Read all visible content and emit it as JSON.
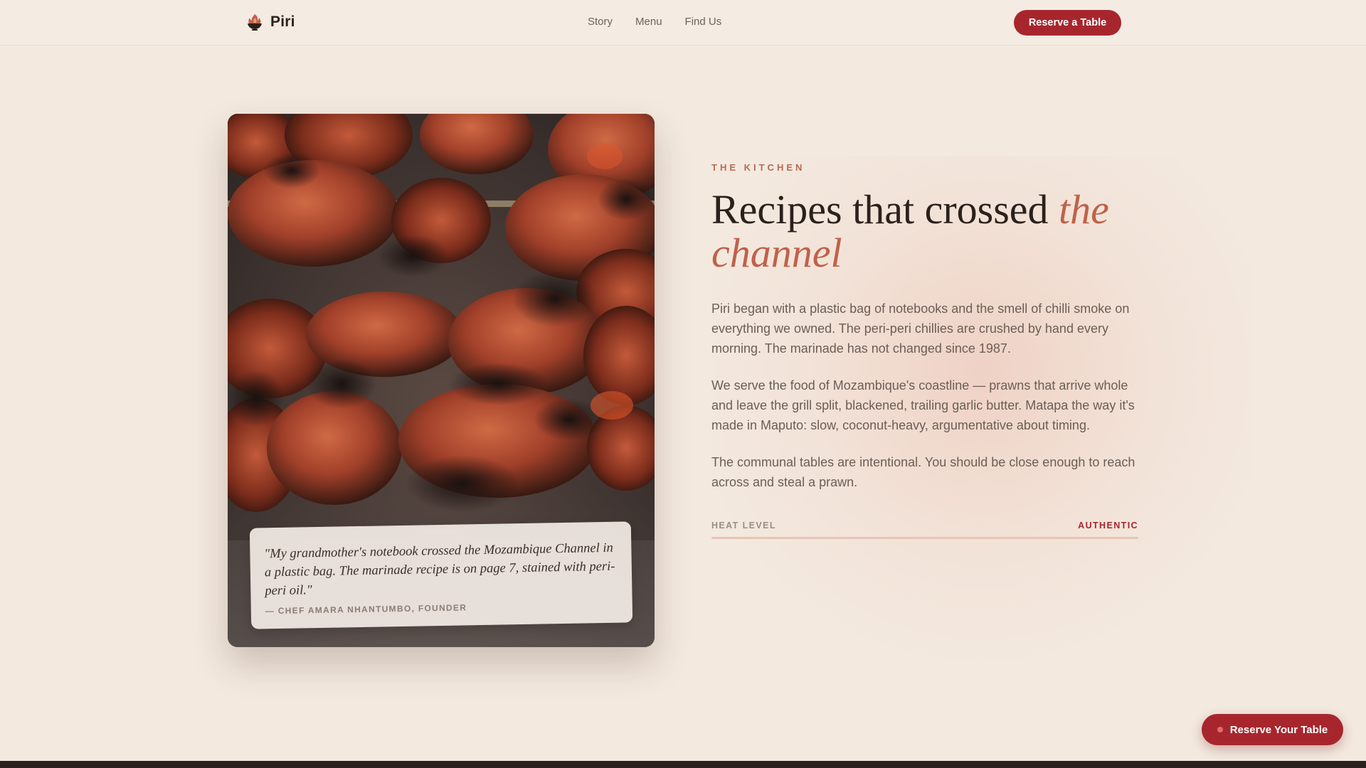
{
  "header": {
    "brand": "Piri",
    "brand_icon": "flame-bowl-icon",
    "nav": [
      "Story",
      "Menu",
      "Find Us"
    ],
    "cta": "Reserve a Table"
  },
  "photo": {
    "alt": "grilled skewers icon",
    "quote": "\"My grandmother's notebook crossed the Mozambique Channel in a plastic bag. The marinade recipe is on page 7, stained with peri-peri oil.\"",
    "author": "— CHEF AMARA NHANTUMBO, FOUNDER"
  },
  "story": {
    "eyebrow": "THE KITCHEN",
    "headline_plain": "Recipes that crossed ",
    "headline_em": "the channel",
    "paragraphs": [
      "Piri began with a plastic bag of notebooks and the smell of chilli smoke on everything we owned. The peri-peri chillies are crushed by hand every morning. The marinade has not changed since 1987.",
      "We serve the food of Mozambique's coastline — prawns that arrive whole and leave the grill split, blackened, trailing garlic butter. Matapa the way it's made in Maputo: slow, coconut-heavy, argumentative about timing.",
      "The communal tables are intentional. You should be close enough to reach across and steal a prawn."
    ],
    "heat_label": "HEAT LEVEL",
    "heat_value": "AUTHENTIC",
    "heat_level_fraction": 1.0
  },
  "floating_cta": "Reserve Your Table",
  "colors": {
    "accent": "#a7262d",
    "background": "#f3e9df",
    "headline_em": "#c0614a"
  }
}
